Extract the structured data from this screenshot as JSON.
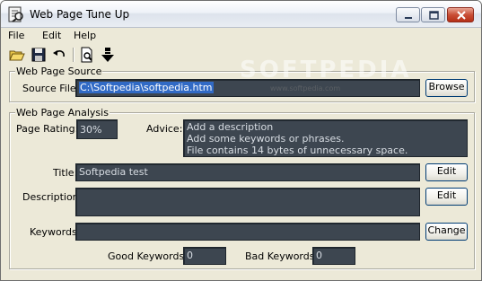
{
  "window": {
    "title": "Web Page Tune Up"
  },
  "menu": {
    "items": [
      "File",
      "Edit",
      "Help"
    ]
  },
  "toolbar": {
    "icons": [
      "open-folder-icon",
      "save-disk-icon",
      "undo-icon",
      "preview-page-icon",
      "download-arrow-icon"
    ]
  },
  "source": {
    "group_title": "Web Page Source",
    "file_label": "Source File:",
    "file_value": "C:\\Softpedia\\softpedia.htm",
    "browse_label": "Browse"
  },
  "analysis": {
    "group_title": "Web Page Analysis",
    "rating_label": "Page Rating:",
    "rating_value": "30%",
    "advice_label": "Advice:",
    "advice_lines": [
      "Add a description",
      "Add some keywords or phrases.",
      "File contains 14 bytes of unnecessary space."
    ],
    "title_label": "Title:",
    "title_value": "Softpedia test",
    "title_edit_label": "Edit",
    "description_label": "Description:",
    "description_value": "",
    "description_edit_label": "Edit",
    "keywords_label": "Keywords:",
    "keywords_value": "",
    "keywords_change_label": "Change",
    "good_keywords_label": "Good Keywords:",
    "good_keywords_value": "0",
    "bad_keywords_label": "Bad Keywords:",
    "bad_keywords_value": "0"
  },
  "watermark": {
    "text": "SOFTPEDIA",
    "url": "www.softpedia.com"
  },
  "colors": {
    "field_bg": "#3d4650",
    "selection": "#316ac5",
    "window_bg": "#ece9d8"
  }
}
